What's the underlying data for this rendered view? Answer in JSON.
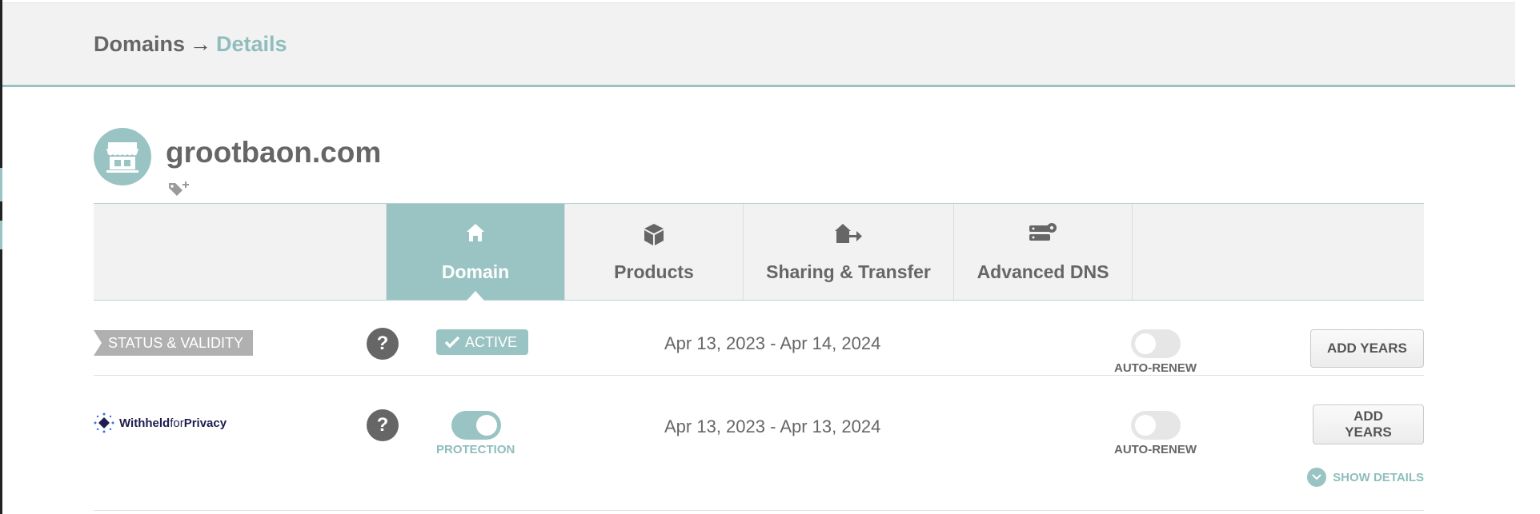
{
  "breadcrumb": {
    "root": "Domains",
    "separator": "→",
    "current": "Details"
  },
  "domain": {
    "name": "grootbaon.com"
  },
  "tabs": [
    {
      "label": "Domain",
      "icon": "house-icon",
      "active": true
    },
    {
      "label": "Products",
      "icon": "box-icon",
      "active": false
    },
    {
      "label": "Sharing & Transfer",
      "icon": "house-arrow-icon",
      "active": false
    },
    {
      "label": "Advanced DNS",
      "icon": "server-gear-icon",
      "active": false
    }
  ],
  "status_row": {
    "label": "STATUS & VALIDITY",
    "help": "?",
    "badge": "ACTIVE",
    "dates": "Apr 13, 2023 - Apr 14, 2024",
    "auto_renew": {
      "label": "AUTO-RENEW",
      "on": false
    },
    "button": "ADD YEARS"
  },
  "privacy_row": {
    "logo_text": {
      "withheld": "Withheld",
      "for": "for",
      "privacy": "Privacy"
    },
    "help": "?",
    "protection": {
      "label": "PROTECTION",
      "on": true
    },
    "dates": "Apr 13, 2023 - Apr 13, 2024",
    "auto_renew": {
      "label": "AUTO-RENEW",
      "on": false
    },
    "button": "ADD YEARS",
    "show_details": "SHOW DETAILS"
  },
  "colors": {
    "accent": "#9ac3c3",
    "accent_text": "#8fbdbd",
    "text": "#666666",
    "bar_bg": "#f2f2f2"
  }
}
